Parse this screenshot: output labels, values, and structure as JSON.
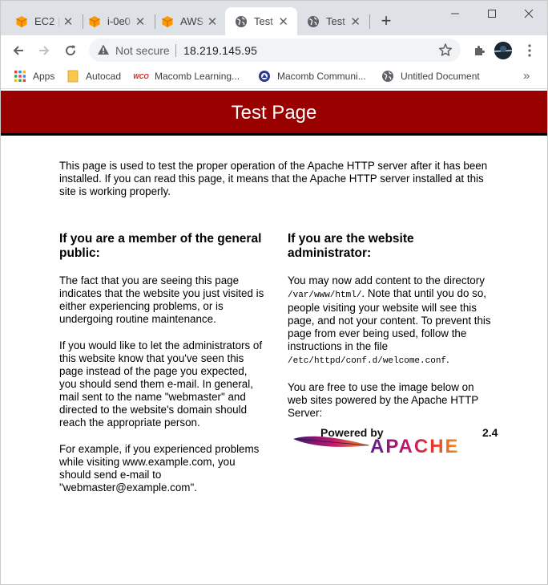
{
  "tabs": [
    {
      "title": "EC2 |",
      "icon": "aws-orange-box-icon"
    },
    {
      "title": "i-0e0",
      "icon": "aws-orange-box-icon"
    },
    {
      "title": "AWS",
      "icon": "aws-orange-box-icon"
    },
    {
      "title": "Test P",
      "icon": "globe-icon",
      "active": true
    },
    {
      "title": "Test",
      "icon": "globe-icon"
    }
  ],
  "omnibox": {
    "security": "Not secure",
    "url": "18.219.145.95"
  },
  "bookmarks": [
    {
      "label": "Apps",
      "icon": "apps-grid-icon"
    },
    {
      "label": "Autocad",
      "icon": "folder-icon"
    },
    {
      "label": "Macomb Learning...",
      "icon": "wco-icon",
      "icon_text": "WCO"
    },
    {
      "label": "Macomb Communi...",
      "icon": "macomb-seal-icon"
    },
    {
      "label": "Untitled Document",
      "icon": "globe-icon"
    }
  ],
  "page": {
    "banner_title": "Test Page",
    "intro": "This page is used to test the proper operation of the Apache HTTP server after it has been installed. If you can read this page, it means that the Apache HTTP server installed at this site is working properly.",
    "public": {
      "heading": "If you are a member of the general public:",
      "p1": "The fact that you are seeing this page indicates that the website you just visited is either experiencing problems, or is undergoing routine maintenance.",
      "p2": "If you would like to let the administrators of this website know that you've seen this page instead of the page you expected, you should send them e-mail. In general, mail sent to the name \"webmaster\" and directed to the website's domain should reach the appropriate person.",
      "p3": "For example, if you experienced problems while visiting www.example.com, you should send e-mail to \"webmaster@example.com\"."
    },
    "admin": {
      "heading": "If you are the website administrator:",
      "p1_a": "You may now add content to the directory ",
      "p1_code": "/var/www/html/",
      "p1_b": ". Note that until you do so, people visiting your website will see this page, and not your content. To prevent this page from ever being used, follow the instructions in the file ",
      "p1_code2": "/etc/httpd/conf.d/welcome.conf",
      "p1_c": ".",
      "p2": "You are free to use the image below on web sites powered by the Apache HTTP Server:"
    },
    "powered_by": {
      "label": "Powered by",
      "brand": "APACHE",
      "version": "2.4"
    }
  }
}
